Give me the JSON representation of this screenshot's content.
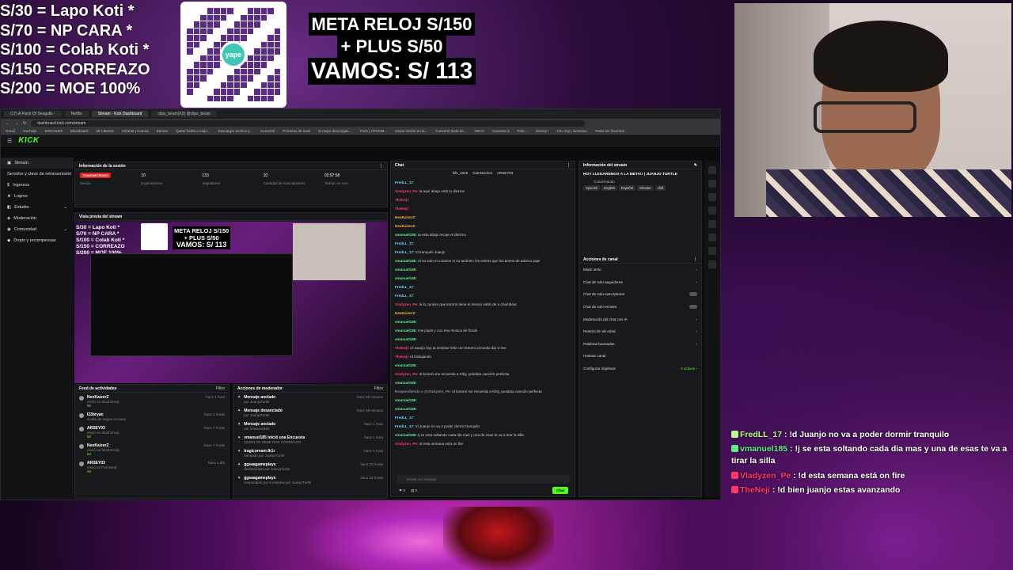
{
  "overlay": {
    "goals": [
      "S/30 = Lapo Koti *",
      "S/70 =  NP CARA *",
      "S/100 = Colab Koti *",
      "S/150 = CORREAZO",
      "S/200 = MOE 100%"
    ],
    "qr_brand": "yape",
    "meta_line1": "META RELOJ S/150",
    "meta_line2": "+ PLUS S/50",
    "meta_line3": "VAMOS: S/ 113"
  },
  "browser": {
    "tabs": [
      "(17) A Flock Of Seagulls -",
      "Netflix",
      "Stream - Kick Dashboard",
      "clips_beam(X2) @clips_beam"
    ],
    "url": "dashboard.kick.com/stream",
    "bookmarks": [
      "Gmail",
      "YouTube",
      "SOCIALES",
      "Blackboard",
      "Mi Cibertec",
      "Intranet | Cuenta",
      "Banner",
      "Quitar fondo a mejo...",
      "Descargar archivo y...",
      "Convertir",
      "Primeras de nivel",
      "Si mejor descargas...",
      "YAVA | HYCOM...",
      "Iniciar sesión en la...",
      "Convertir texto de...",
      "INGYI",
      "Cuevana 3",
      "Pelic...",
      "Disney+",
      "Chu Joy | Juventus",
      "Todos los favoritos"
    ]
  },
  "kick": {
    "logo": "KICK",
    "sidebar": [
      "Stream",
      "Servidor y clave de retransmisión",
      "Ingresos",
      "Logros",
      "Estudio",
      "Moderación",
      "Comunidad",
      "Drops y recompensas"
    ],
    "session": {
      "title": "Información de la sesión",
      "live_badge": "TRANSMITIENDO",
      "sesion_label": "Sesión",
      "viewers": "10",
      "viewers_label": "Espectadores",
      "followers": "133",
      "followers_label": "Seguidores",
      "subs": "10",
      "subs_label": "Cantidad de suscripciones",
      "time": "02:07:58",
      "time_label": "Tiempo en vivo"
    },
    "preview_title": "Vista previa del stream",
    "activity": {
      "title": "Feed de actividades",
      "filter": "Filtro",
      "rows": [
        {
          "name": "NeoKaizerZ",
          "action": "envió un Skull Emoji",
          "amount": "50",
          "time": "hace 1 hora"
        },
        {
          "name": "I23bryan",
          "action": "acaba de seguir el canal",
          "amount": "",
          "time": "hace 2 horas"
        },
        {
          "name": "ARSEY03",
          "action": "envió un Skull Emoji",
          "amount": "50",
          "time": "hace 7 horas"
        },
        {
          "name": "NeoKaizerZ",
          "action": "envió un Skull Emoji",
          "amount": "50",
          "time": "hace 7 horas"
        },
        {
          "name": "ARSEY03",
          "action": "envió un Full Send",
          "amount": "50",
          "time": "hace 1 día"
        }
      ]
    },
    "modactions": {
      "title": "Acciones de moderador",
      "filter": "Filtro",
      "rows": [
        {
          "name": "Mensaje anclado",
          "by": "por JuanjoTurtle",
          "time": "hace 39 minutos"
        },
        {
          "name": "Mensaje desanclado",
          "by": "por JuanjoTurtle",
          "time": "hace 39 minutos"
        },
        {
          "name": "Mensaje anclado",
          "by": "por vmanuel185",
          "time": "hace 1 hora"
        },
        {
          "name": "vmanuel185 inició una Encuesta",
          "by": "QUIEN TE DEBE DAR CORREAZO",
          "time": "hace 1 hora"
        },
        {
          "name": "tragicoream:lk1r",
          "by": "baneado por JuanjoTurtle",
          "time": "hace 1 hora"
        },
        {
          "name": "ggsaagameplays",
          "by": "desbaneado por JuanjoTurtle",
          "time": "hace 23 horas"
        },
        {
          "name": "ggsaagameplays",
          "by": "suspendido por 5 minutos por JuanjoTurtle",
          "time": "hace 23 horas"
        }
      ]
    },
    "chat": {
      "title": "Chat",
      "top_gifters": [
        "fdlc_2025",
        "GianNoches",
        "ARSEY03"
      ],
      "messages": [
        {
          "user": "FredLL_17",
          "text": ""
        },
        {
          "user": "Vladyzen_Pe",
          "text": "la aquí abajo está tu diezmo"
        },
        {
          "user": "TheNeji",
          "text": ""
        },
        {
          "user": "TheNeji",
          "text": ""
        },
        {
          "user": "NeoKaizerZ",
          "text": ""
        },
        {
          "user": "NeoKaizerZ",
          "text": ""
        },
        {
          "user": "vmanuel185",
          "text": "ta esta abajo recoje el diezmo"
        },
        {
          "user": "FredLL_17",
          "text": ""
        },
        {
          "user": "FredLL_17",
          "text": "!d tranquilo Juanjo"
        },
        {
          "user": "vmanuel185",
          "text": "!d no solo el corazon si no tambien los webos que los tienes de adorno papi"
        },
        {
          "user": "vmanuel185",
          "text": ""
        },
        {
          "user": "vmanuel185",
          "text": ""
        },
        {
          "user": "FredLL_17",
          "text": ""
        },
        {
          "user": "FredLL_17",
          "text": ""
        },
        {
          "user": "Vladyzen_Pe",
          "text": "la lo curioso que kotorni tiene el mismo estilo de a chambear"
        },
        {
          "user": "NeoKaizerZ",
          "text": ""
        },
        {
          "user": "vmanuel185",
          "text": ""
        },
        {
          "user": "vmanuel185",
          "text": "mis papis y con esa musica de fondo"
        },
        {
          "user": "vmanuel185",
          "text": ""
        },
        {
          "user": "TheNeji",
          "text": "!d Juanjo hoy ta sentiste feliz con kotorni al medio dia vi live"
        },
        {
          "user": "TheNeji",
          "text": "!d trabajando"
        },
        {
          "user": "vmanuel185",
          "text": ""
        },
        {
          "user": "Vladyzen_Pe",
          "text": "!d kotorni me recuerda a Kitty, posdata canción perfecta"
        },
        {
          "user": "vmanuel185",
          "text": ""
        },
        {
          "user": "Respondiendo a @Vladyzen_Pe",
          "text": "!d kotorni me recuerda a Kitty, posdata canción perfecta"
        },
        {
          "user": "vmanuel185",
          "text": ""
        },
        {
          "user": "vmanuel185",
          "text": ""
        },
        {
          "user": "FredLL_17",
          "text": ""
        },
        {
          "user": "FredLL_17",
          "text": "!d Juanjo no va a poder dormir tranquilo"
        },
        {
          "user": "vmanuel185",
          "text": "!j se esta soltando cada dia mas y una de esas te va a tirar la silla"
        },
        {
          "user": "Vladyzen_Pe",
          "text": "!d esta semana está on fire"
        },
        {
          "user": "TheNeji",
          "text": "!d bien juanjo estas avanzando"
        }
      ],
      "input_placeholder": "Enviar un mensaje",
      "send_label": "Chat",
      "counts": [
        "0",
        "0"
      ]
    },
    "stream_info": {
      "title": "Información del stream",
      "stream_title": "HOY LLEGAREMOS A LA META!! | JUANJO TURTLE",
      "category": "Conversando",
      "tags": [
        "Spanish",
        "English",
        "Español",
        "Shooter",
        "chill"
      ]
    },
    "channel_actions": {
      "title": "Acciones de canal",
      "rows": [
        {
          "label": "Modo lento",
          "kind": "arrow"
        },
        {
          "label": "Chat de solo-seguidores",
          "kind": "arrow"
        },
        {
          "label": "Chat de solo-suscriptores",
          "kind": "toggle"
        },
        {
          "label": "Chat de solo-emotes",
          "kind": "toggle"
        },
        {
          "label": "Moderación del chat con IA",
          "kind": "arrow"
        },
        {
          "label": "Restricción de edad",
          "kind": "arrow"
        },
        {
          "label": "Palabras baneadas",
          "kind": "arrow"
        },
        {
          "label": "Hostear canal",
          "kind": "none"
        },
        {
          "label": "Configurar objetivos",
          "kind": "arrow",
          "extra": "2 activos"
        }
      ]
    }
  },
  "overlay_chat": [
    {
      "user": "FredLL_17",
      "text": " : !d Juanjo no va a poder dormir tranquilo",
      "color": "#b8ff8a"
    },
    {
      "user": "vmanuel185",
      "text": " : !j se esta soltando cada dia mas y una de esas te va a tirar la silla",
      "color": "#5cf08a"
    },
    {
      "user": "Vladyzen_Pe",
      "text": " : !d esta semana está on fire",
      "color": "#ff3a6a"
    },
    {
      "user": "TheNeji",
      "text": " : !d bien juanjo estas avanzando",
      "color": "#ff3a6a"
    }
  ],
  "colors": {
    "kick_green": "#53fc18",
    "live_red": "#e02020",
    "qr_purple": "#5b2b8a"
  }
}
